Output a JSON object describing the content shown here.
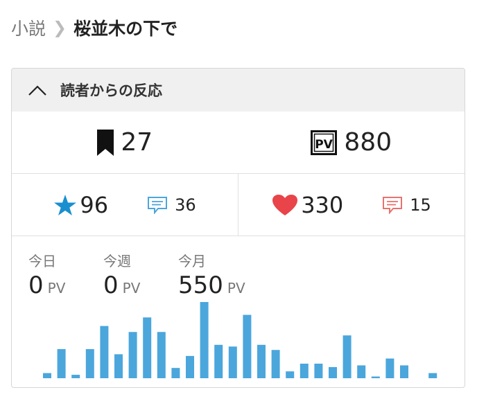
{
  "breadcrumb": {
    "parent": "小説",
    "current": "桜並木の下で"
  },
  "panel": {
    "title": "読者からの反応",
    "bookmarks": "27",
    "pv_total": "880",
    "stars": "96",
    "star_comments": "36",
    "likes": "330",
    "like_comments": "15",
    "pv_stats": [
      {
        "label": "今日",
        "value": "0",
        "unit": "PV"
      },
      {
        "label": "今週",
        "value": "0",
        "unit": "PV"
      },
      {
        "label": "今月",
        "value": "550",
        "unit": "PV"
      }
    ]
  },
  "colors": {
    "bar": "#4ba6dc",
    "star": "#1a8fd0",
    "heart": "#e8444a",
    "star_comment": "#4ba6dc",
    "heart_comment": "#e8726f"
  },
  "chart_data": {
    "type": "bar",
    "series": [
      {
        "values": [
          6,
          34,
          4,
          34,
          61,
          28,
          54,
          71,
          54,
          12,
          26,
          89,
          39,
          37,
          74,
          39,
          33,
          8,
          17,
          17,
          13,
          50,
          15,
          2,
          23,
          15,
          0,
          6
        ]
      }
    ]
  }
}
